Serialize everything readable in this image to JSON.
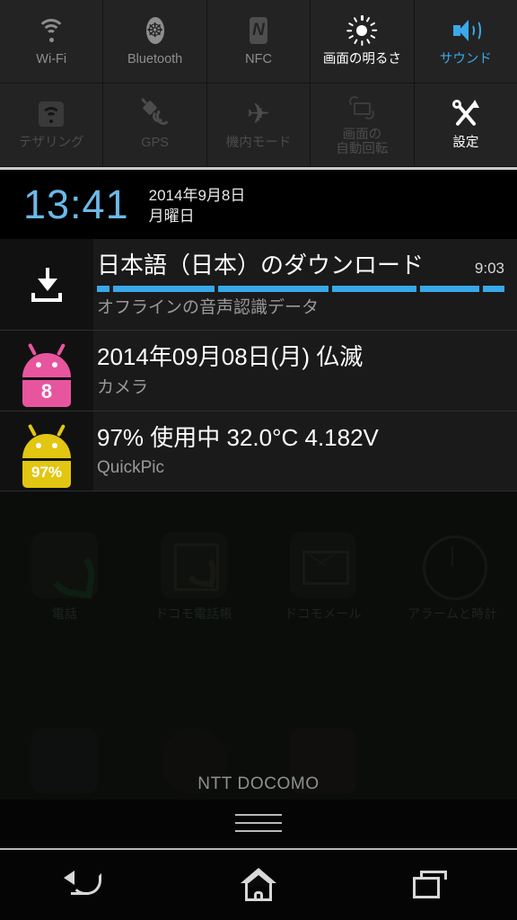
{
  "quick_settings": {
    "rows": [
      [
        {
          "icon": "wifi-icon",
          "label": "Wi-Fi",
          "state": "off"
        },
        {
          "icon": "bluetooth-icon",
          "label": "Bluetooth",
          "state": "off"
        },
        {
          "icon": "nfc-icon",
          "label": "NFC",
          "state": "off"
        },
        {
          "icon": "brightness-icon",
          "label": "画面の明るさ",
          "state": "on"
        },
        {
          "icon": "sound-icon",
          "label": "サウンド",
          "state": "highlighted"
        }
      ],
      [
        {
          "icon": "tethering-icon",
          "label": "テザリング",
          "state": "dim"
        },
        {
          "icon": "gps-icon",
          "label": "GPS",
          "state": "dim"
        },
        {
          "icon": "airplane-mode-icon",
          "label": "機内モード",
          "state": "dim"
        },
        {
          "icon": "auto-rotate-icon",
          "label": "画面の\n自動回転",
          "state": "dim"
        },
        {
          "icon": "settings-icon",
          "label": "設定",
          "state": "on"
        }
      ]
    ]
  },
  "clock": {
    "time": "13:41",
    "date": "2014年9月8日",
    "weekday": "月曜日",
    "time_color": "#6cb9e8"
  },
  "notifications": [
    {
      "icon": "download-icon",
      "title": "日本語（日本）のダウンロード",
      "time": "9:03",
      "subtitle": "オフラインの音声認識データ",
      "progress": {
        "indeterminate": true,
        "color": "#39a8e8",
        "segments": [
          20,
          168,
          180,
          140,
          96,
          36
        ]
      }
    },
    {
      "icon": "android-robot-icon",
      "icon_color": "#e8559f",
      "icon_badge": "8",
      "title": "2014年09月08日(月) 仏滅",
      "time": "",
      "subtitle": "カメラ"
    },
    {
      "icon": "android-robot-icon",
      "icon_color": "#e2c612",
      "icon_badge": "97%",
      "title": "97%  使用中  32.0°C  4.182V",
      "time": "",
      "subtitle": "QuickPic"
    }
  ],
  "home_screen": {
    "apps": [
      {
        "icon": "phone-icon",
        "label": "電話"
      },
      {
        "icon": "docomo-contacts-icon",
        "label": "ドコモ電話帳"
      },
      {
        "icon": "docomo-mail-icon",
        "label": "ドコモメール"
      },
      {
        "icon": "alarm-clock-icon",
        "label": "アラームと時計"
      }
    ],
    "carrier": "NTT DOCOMO"
  },
  "navigation": {
    "back": "back-button",
    "home": "home-button",
    "recents": "recents-button",
    "handle": "shade-drag-handle"
  }
}
